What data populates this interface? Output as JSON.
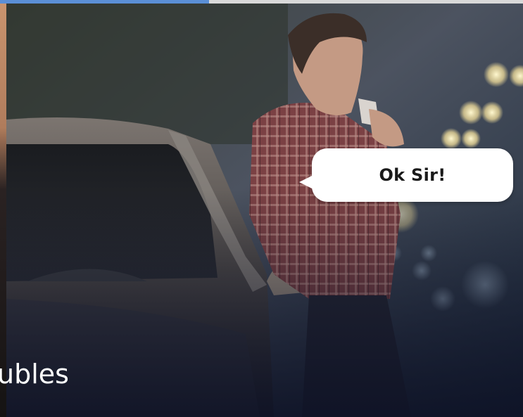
{
  "slider": {
    "progress_fraction": 0.4,
    "colors": {
      "progress_fill": "#5b8fd6",
      "progress_track": "#d9d9d9"
    }
  },
  "slide": {
    "speech_bubble_text": "Ok Sir!",
    "caption_text": "ubles"
  }
}
